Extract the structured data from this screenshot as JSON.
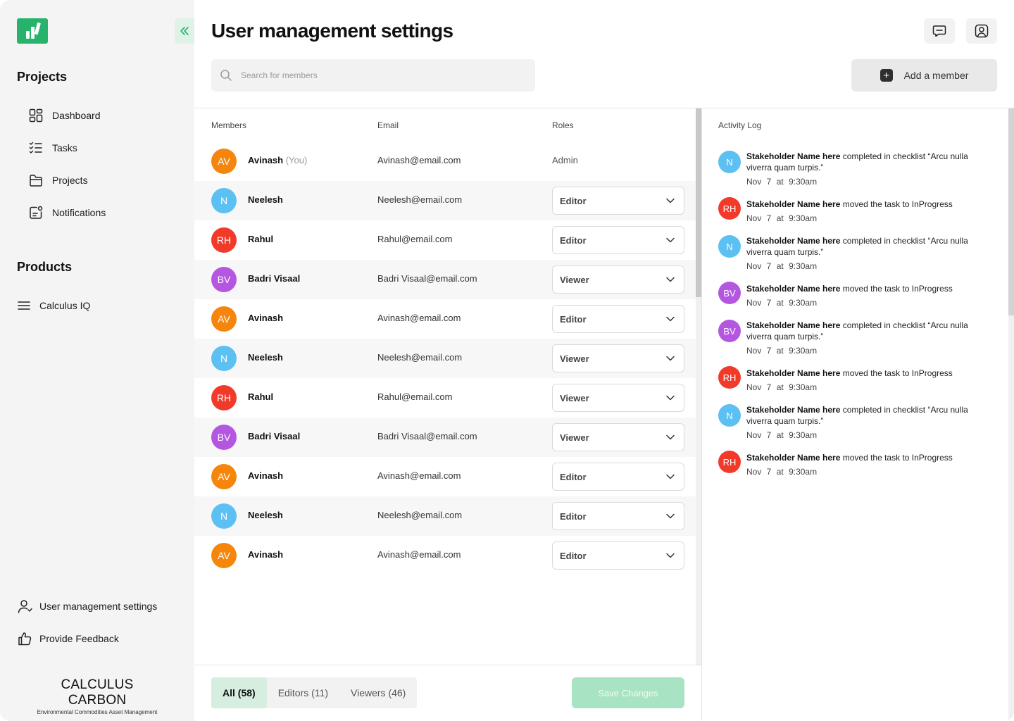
{
  "sidebar": {
    "projects_heading": "Projects",
    "nav": [
      {
        "label": "Dashboard",
        "icon": "dashboard-icon"
      },
      {
        "label": "Tasks",
        "icon": "tasks-icon"
      },
      {
        "label": "Projects",
        "icon": "folder-icon"
      },
      {
        "label": "Notifications",
        "icon": "notifications-icon"
      }
    ],
    "products_heading": "Products",
    "products": [
      {
        "label": "Calculus IQ",
        "icon": "menu-icon"
      }
    ],
    "bottom": [
      {
        "label": "User management settings",
        "icon": "user-icon"
      },
      {
        "label": "Provide Feedback",
        "icon": "thumbs-up-icon"
      }
    ],
    "brand": {
      "name": "CALCULUS CARBON",
      "tagline": "Environmental Commodities Asset Management"
    }
  },
  "header": {
    "title": "User management settings",
    "search_placeholder": "Search for members",
    "add_member_label": "Add a member"
  },
  "table": {
    "columns": {
      "members": "Members",
      "email": "Email",
      "roles": "Roles"
    },
    "rows": [
      {
        "initials": "AV",
        "color": "#f5860b",
        "name": "Avinash",
        "you": "(You)",
        "email": "Avinash@email.com",
        "role": "Admin",
        "editable": false
      },
      {
        "initials": "N",
        "color": "#5cc0f2",
        "name": "Neelesh",
        "email": "Neelesh@email.com",
        "role": "Editor",
        "editable": true
      },
      {
        "initials": "RH",
        "color": "#f23a2b",
        "name": "Rahul",
        "email": "Rahul@email.com",
        "role": "Editor",
        "editable": true
      },
      {
        "initials": "BV",
        "color": "#b456e0",
        "name": "Badri Visaal",
        "email": "Badri Visaal@email.com",
        "role": "Viewer",
        "editable": true
      },
      {
        "initials": "AV",
        "color": "#f5860b",
        "name": "Avinash",
        "email": "Avinash@email.com",
        "role": "Editor",
        "editable": true
      },
      {
        "initials": "N",
        "color": "#5cc0f2",
        "name": "Neelesh",
        "email": "Neelesh@email.com",
        "role": "Viewer",
        "editable": true
      },
      {
        "initials": "RH",
        "color": "#f23a2b",
        "name": "Rahul",
        "email": "Rahul@email.com",
        "role": "Viewer",
        "editable": true
      },
      {
        "initials": "BV",
        "color": "#b456e0",
        "name": "Badri Visaal",
        "email": "Badri Visaal@email.com",
        "role": "Viewer",
        "editable": true
      },
      {
        "initials": "AV",
        "color": "#f5860b",
        "name": "Avinash",
        "email": "Avinash@email.com",
        "role": "Editor",
        "editable": true
      },
      {
        "initials": "N",
        "color": "#5cc0f2",
        "name": "Neelesh",
        "email": "Neelesh@email.com",
        "role": "Editor",
        "editable": true
      },
      {
        "initials": "AV",
        "color": "#f5860b",
        "name": "Avinash",
        "email": "Avinash@email.com",
        "role": "Editor",
        "editable": true
      }
    ]
  },
  "footer": {
    "filters": [
      {
        "label": "All (58)",
        "active": true
      },
      {
        "label": "Editors (11)",
        "active": false
      },
      {
        "label": "Viewers (46)",
        "active": false
      }
    ],
    "save_label": "Save Changes"
  },
  "activity": {
    "title": "Activity Log",
    "items": [
      {
        "initials": "N",
        "color": "#5cc0f2",
        "actor": "Stakeholder Name here",
        "text": "completed in checklist “Arcu nulla viverra quam turpis.”",
        "date": "Nov 7",
        "at": "at",
        "time": "9:30am",
        "lines": 2
      },
      {
        "initials": "RH",
        "color": "#f23a2b",
        "actor": "Stakeholder Name here",
        "text": "moved the task to InProgress",
        "date": "Nov 7",
        "at": "at",
        "time": "9:30am",
        "lines": 1
      },
      {
        "initials": "N",
        "color": "#5cc0f2",
        "actor": "Stakeholder Name here",
        "text": "completed in checklist “Arcu nulla viverra quam turpis.”",
        "date": "Nov 7",
        "at": "at",
        "time": "9:30am",
        "lines": 2
      },
      {
        "initials": "BV",
        "color": "#b456e0",
        "actor": "Stakeholder Name here",
        "text": "moved the task to InProgress",
        "date": "Nov 7",
        "at": "at",
        "time": "9:30am",
        "lines": 1
      },
      {
        "initials": "BV",
        "color": "#b456e0",
        "actor": "Stakeholder Name here",
        "text": "completed in checklist “Arcu nulla viverra quam turpis.”",
        "date": "Nov 7",
        "at": "at",
        "time": "9:30am",
        "lines": 2
      },
      {
        "initials": "RH",
        "color": "#f23a2b",
        "actor": "Stakeholder Name here",
        "text": "moved the task to InProgress",
        "date": "Nov 7",
        "at": "at",
        "time": "9:30am",
        "lines": 1
      },
      {
        "initials": "N",
        "color": "#5cc0f2",
        "actor": "Stakeholder Name here",
        "text": "completed in checklist “Arcu nulla viverra quam turpis.”",
        "date": "Nov 7",
        "at": "at",
        "time": "9:30am",
        "lines": 2
      },
      {
        "initials": "RH",
        "color": "#f23a2b",
        "actor": "Stakeholder Name here",
        "text": "moved the task to InProgress",
        "date": "Nov 7",
        "at": "at",
        "time": "9:30am",
        "lines": 1
      }
    ]
  },
  "colors": {
    "accent": "#27b36b",
    "save_disabled": "#a8e3c3",
    "active_filter": "#d6eedf"
  }
}
